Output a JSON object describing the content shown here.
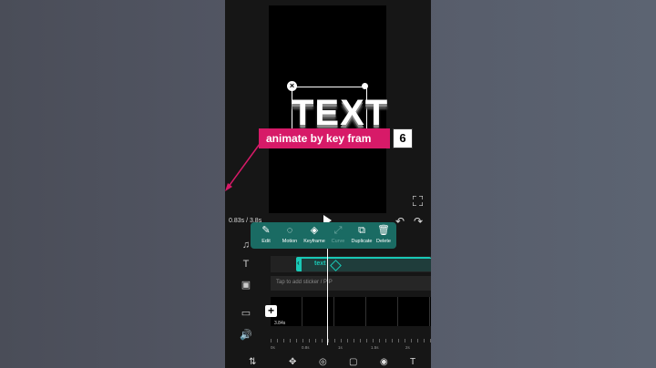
{
  "preview": {
    "overlay_text": "TEXT",
    "close_glyph": "×"
  },
  "playback": {
    "current_time": "0.83s / 3.8s",
    "undo_icon": "↶",
    "redo_icon": "↷"
  },
  "toolbar": {
    "items": [
      {
        "label": "Edit",
        "icon": "edit-icon",
        "glyph": "✎"
      },
      {
        "label": "Motion",
        "icon": "motion-icon",
        "glyph": "◌"
      },
      {
        "label": "Keyframe",
        "icon": "keyframe-icon",
        "glyph": "◈"
      },
      {
        "label": "Curve",
        "icon": "curve-icon",
        "glyph": "⤢"
      },
      {
        "label": "Duplicate",
        "icon": "duplicate-icon",
        "glyph": "⧉"
      },
      {
        "label": "Delete",
        "icon": "delete-icon",
        "glyph": "🗑"
      }
    ]
  },
  "timeline": {
    "text_clip_label": "text",
    "sticker_placeholder": "Tap to add sticker / PIP",
    "add_glyph": "+",
    "strip_time": "3.84s",
    "ruler": [
      "0s",
      "0.8s",
      "1s",
      "1.5s",
      "2s"
    ]
  },
  "callout": {
    "text": "animate by key fram",
    "step": "6",
    "accent": "#d71a68"
  },
  "colors": {
    "teal": "#19c9b6",
    "toolbar_bg": "#1a6b63"
  }
}
